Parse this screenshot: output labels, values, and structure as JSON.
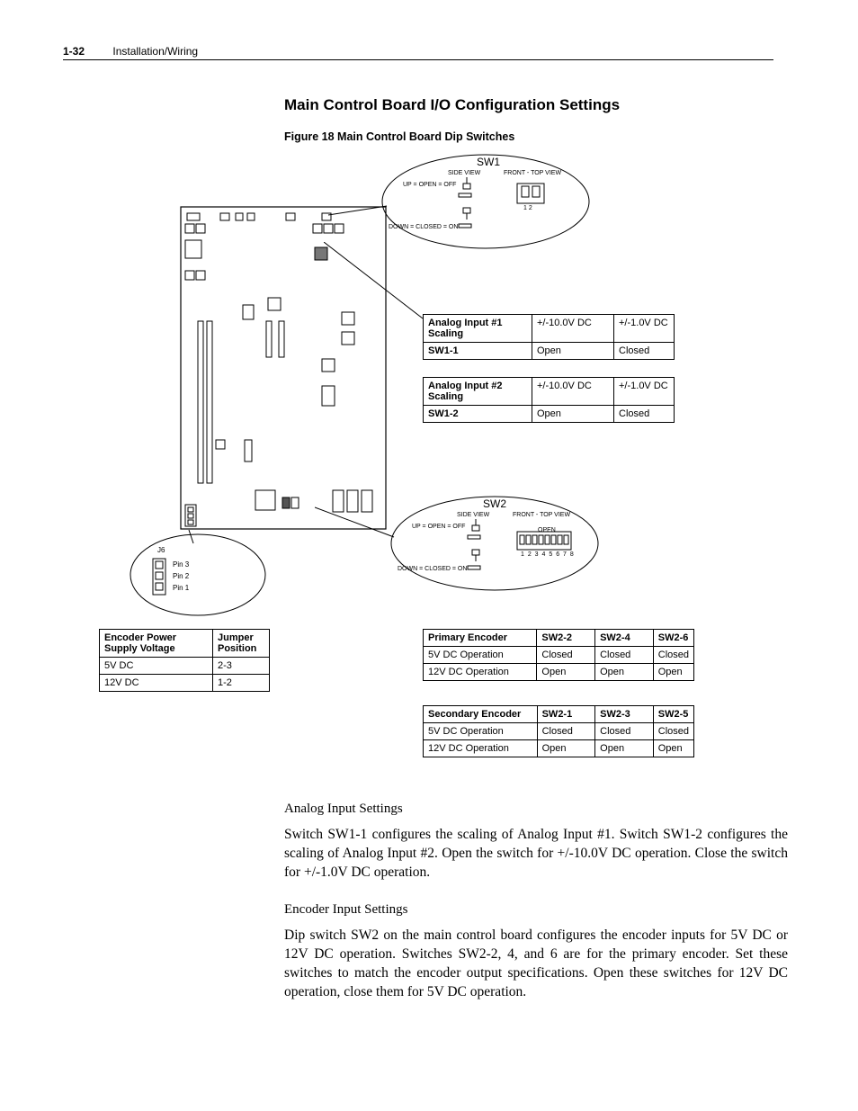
{
  "header": {
    "page": "1-32",
    "section": "Installation/Wiring"
  },
  "title": "Main Control Board I/O Configuration Settings",
  "figure_caption": "Figure 18   Main Control Board Dip Switches",
  "sw1": {
    "label": "SW1",
    "side_view": "SIDE VIEW",
    "front_view": "FRONT - TOP VIEW",
    "up_label": "UP = OPEN = OFF",
    "down_label": "DOWN = CLOSED = ON",
    "switch_numbers": "1 2"
  },
  "sw2": {
    "label": "SW2",
    "side_view": "SIDE VIEW",
    "front_view": "FRONT - TOP VIEW",
    "up_label": "UP = OPEN = OFF",
    "down_label": "DOWN = CLOSED = ON",
    "open_text": "OPEN",
    "switch_numbers": "1 2 3 4 5 6 7 8"
  },
  "j6": {
    "label": "J6",
    "pins": [
      "Pin 3",
      "Pin 2",
      "Pin 1"
    ]
  },
  "analog1_table": {
    "r1c1": "Analog Input #1 Scaling",
    "r1c2": "+/-10.0V DC",
    "r1c3": "+/-1.0V DC",
    "r2c1": "SW1-1",
    "r2c2": "Open",
    "r2c3": "Closed"
  },
  "analog2_table": {
    "r1c1": "Analog Input #2 Scaling",
    "r1c2": "+/-10.0V DC",
    "r1c3": "+/-1.0V DC",
    "r2c1": "SW1-2",
    "r2c2": "Open",
    "r2c3": "Closed"
  },
  "encoder_power_table": {
    "h1": "Encoder Power Supply Voltage",
    "h2": "Jumper Position",
    "r1c1": "5V DC",
    "r1c2": "2-3",
    "r2c1": "12V DC",
    "r2c2": "1-2"
  },
  "primary_encoder_table": {
    "h1": "Primary Encoder",
    "h2": "SW2-2",
    "h3": "SW2-4",
    "h4": "SW2-6",
    "r1c1": "5V DC Operation",
    "r1c2": "Closed",
    "r1c3": "Closed",
    "r1c4": "Closed",
    "r2c1": "12V DC Operation",
    "r2c2": "Open",
    "r2c3": "Open",
    "r2c4": "Open"
  },
  "secondary_encoder_table": {
    "h1": "Secondary Encoder",
    "h2": "SW2-1",
    "h3": "SW2-3",
    "h4": "SW2-5",
    "r1c1": "5V DC Operation",
    "r1c2": "Closed",
    "r1c3": "Closed",
    "r1c4": "Closed",
    "r2c1": "12V DC Operation",
    "r2c2": "Open",
    "r2c3": "Open",
    "r2c4": "Open"
  },
  "analog_heading": "Analog Input Settings",
  "analog_para": "Switch SW1-1 configures the scaling of Analog Input #1. Switch SW1-2 configures the scaling of Analog Input #2. Open the switch for +/-10.0V DC operation. Close the switch for +/-1.0V DC operation.",
  "encoder_heading": "Encoder Input Settings",
  "encoder_para": "Dip switch SW2 on the main control board configures the encoder inputs for 5V DC or 12V DC operation. Switches SW2-2, 4, and 6 are for the primary encoder. Set these switches to match the encoder output specifications. Open these switches for 12V DC operation, close them for 5V DC operation."
}
